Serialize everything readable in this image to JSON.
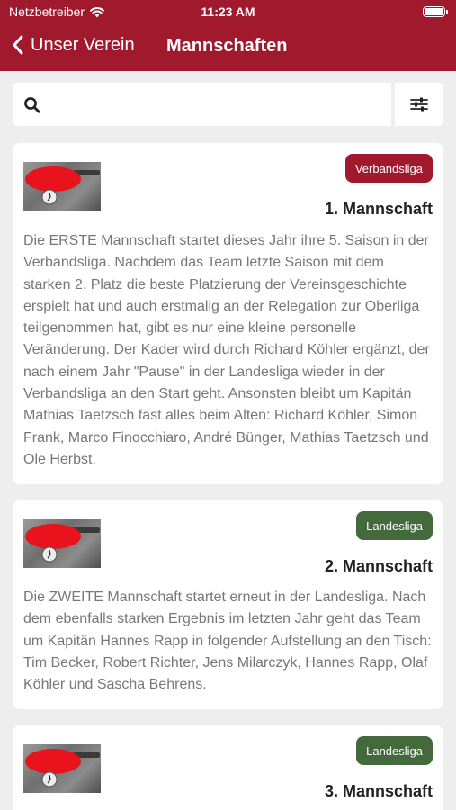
{
  "status_bar": {
    "carrier": "Netzbetreiber",
    "time": "11:23 AM"
  },
  "nav": {
    "back_label": "Unser Verein",
    "title": "Mannschaften"
  },
  "search": {
    "placeholder": ""
  },
  "icons": {
    "back": "chevron-left-icon",
    "search": "magnifier-icon",
    "filter": "sliders-icon",
    "wifi": "wifi-icon",
    "battery": "battery-icon"
  },
  "colors": {
    "primary": "#a0192c",
    "league_green": "#43693c",
    "background": "#eeeeee"
  },
  "teams": [
    {
      "league": "Verbandsliga",
      "name": "1. Mannschaft",
      "description": "Die ERSTE Mannschaft startet dieses Jahr ihre 5. Saison in der Verbandsliga. Nachdem das Team letzte Saison mit dem starken 2. Platz die beste Platzierung der Vereinsgeschichte erspielt hat und auch erstmalig an der Relegation zur Oberliga teilgenommen hat, gibt es nur eine kleine personelle Veränderung. Der Kader wird durch Richard Köhler ergänzt, der nach einem Jahr \"Pause\" in der Landesliga wieder in der Verbandsliga an den Start geht. Ansonsten bleibt um Kapitän Mathias Taetzsch fast alles beim Alten: Richard Köhler, Simon Frank, Marco Finocchiaro, André Bünger, Mathias Taetzsch und Ole Herbst."
    },
    {
      "league": "Landesliga",
      "name": "2. Mannschaft",
      "description": "Die ZWEITE Mannschaft startet erneut in der Landesliga. Nach dem ebenfalls starken Ergebnis im letzten Jahr geht das Team um Kapitän Hannes Rapp in folgender Aufstellung an den Tisch: Tim Becker, Robert Richter, Jens Milarczyk, Hannes Rapp, Olaf Köhler und Sascha Behrens."
    },
    {
      "league": "Landesliga",
      "name": "3. Mannschaft",
      "description": ""
    }
  ]
}
